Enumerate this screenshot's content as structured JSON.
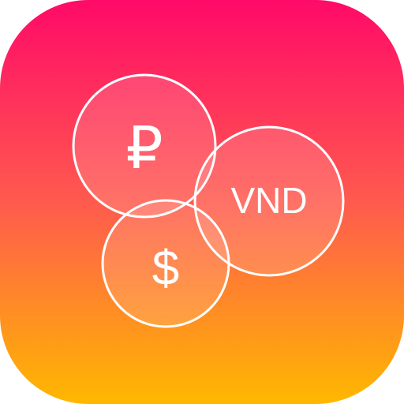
{
  "app_icon": {
    "colors": {
      "gradient_top": "#FF0A68",
      "gradient_bottom": "#FFB800",
      "stroke": "#FFFFFF"
    },
    "coins": [
      {
        "symbol": "₽"
      },
      {
        "symbol": "VND"
      },
      {
        "symbol": "$"
      }
    ]
  }
}
